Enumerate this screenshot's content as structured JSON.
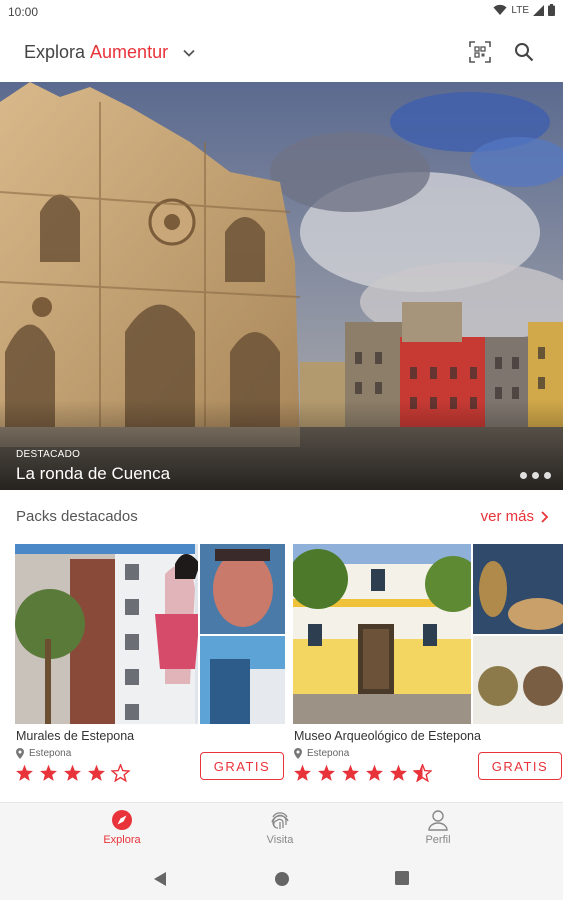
{
  "status_bar": {
    "time": "10:00",
    "network": "LTE"
  },
  "app_bar": {
    "title_prefix": "Explora",
    "title_brand": "Aumentur",
    "icons": [
      "chevron-down-icon",
      "qr-scan-icon",
      "search-icon"
    ]
  },
  "hero": {
    "kicker": "DESTACADO",
    "title": "La ronda de Cuenca",
    "slides": 3
  },
  "packs": {
    "section_title": "Packs destacados",
    "see_more": "ver más",
    "items": [
      {
        "title": "Murales de Estepona",
        "location": "Estepona",
        "rating": 4.0,
        "price_label": "GRATIS"
      },
      {
        "title": "Museo Arqueológico de Estepona",
        "location": "Estepona",
        "rating": 4.5,
        "price_label": "GRATIS"
      }
    ]
  },
  "bottom_nav": {
    "items": [
      {
        "label": "Explora",
        "icon": "compass-icon",
        "active": true
      },
      {
        "label": "Visita",
        "icon": "fingerprint-icon",
        "active": false
      },
      {
        "label": "Perfil",
        "icon": "user-icon",
        "active": false
      }
    ]
  },
  "colors": {
    "accent": "#e8333a",
    "text": "#333333",
    "muted": "#888888",
    "nav_bg": "#f5f5f5"
  }
}
